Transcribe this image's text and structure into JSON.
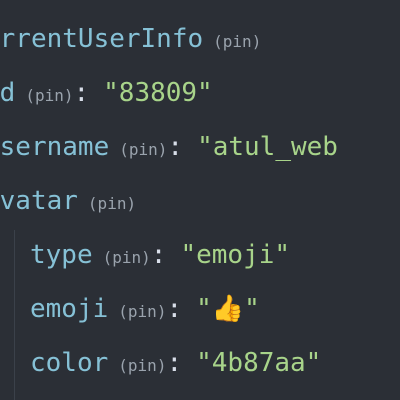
{
  "tree": {
    "root": {
      "key": "urrentUserInfo",
      "pin": "(pin)"
    },
    "id": {
      "key": "id",
      "pin": "(pin)",
      "colon": ":",
      "value": "\"83809\""
    },
    "username": {
      "key": "username",
      "pin": "(pin)",
      "colon": ":",
      "value": "\"atul_web"
    },
    "avatar": {
      "key": "avatar",
      "pin": "(pin)",
      "type": {
        "key": "type",
        "pin": "(pin)",
        "colon": ":",
        "value": "\"emoji\""
      },
      "emoji": {
        "key": "emoji",
        "pin": "(pin)",
        "colon": ":",
        "value": "\"👍\""
      },
      "color": {
        "key": "color",
        "pin": "(pin)",
        "colon": ":",
        "value": "\"4b87aa\""
      }
    }
  },
  "colors": {
    "background": "#2b2f36",
    "key": "#86c1d6",
    "pin": "#9aa3ad",
    "string": "#a8d48a",
    "punctuation": "#d8dee9"
  }
}
